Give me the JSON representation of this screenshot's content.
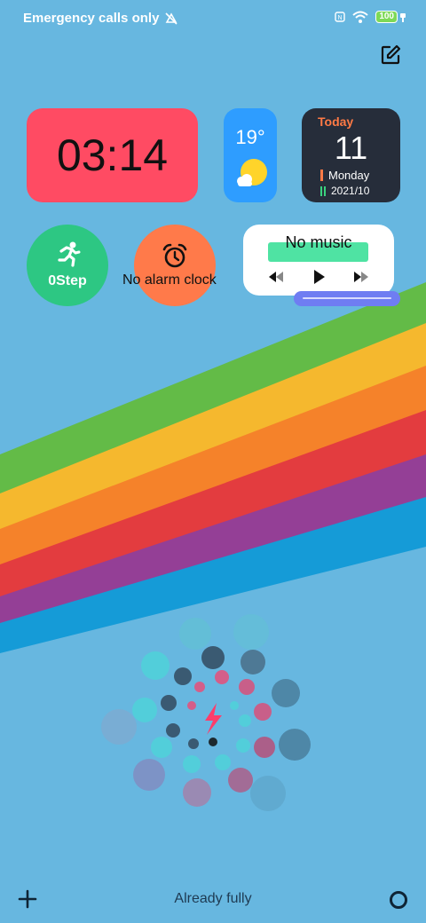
{
  "status_bar": {
    "carrier_text": "Emergency calls only",
    "battery_level": "100"
  },
  "widgets": {
    "clock": {
      "time": "03:14"
    },
    "weather": {
      "temperature": "19°"
    },
    "calendar": {
      "today_label": "Today",
      "day": "11",
      "weekday": "Monday",
      "date": "2021/10"
    },
    "steps": {
      "label": "0Step"
    },
    "alarm": {
      "label": "No alarm clock"
    },
    "music": {
      "title": "No music"
    }
  },
  "charging": {
    "status_text": "Already fully"
  },
  "colors": {
    "background": "#67b7e0",
    "rainbow": [
      "#63bb47",
      "#f5b82e",
      "#f5822a",
      "#e33c3f",
      "#943f96",
      "#159bd7"
    ]
  }
}
